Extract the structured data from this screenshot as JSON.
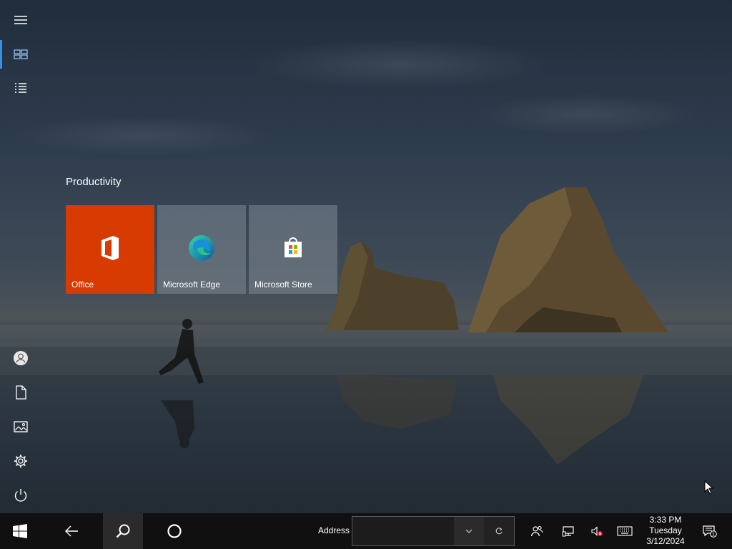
{
  "start": {
    "rail": {
      "menu_icon": "hamburger-icon",
      "tiles_icon": "pinned-tiles-icon",
      "all_apps_icon": "all-apps-list-icon",
      "user_icon": "user-avatar-icon",
      "documents_icon": "documents-icon",
      "pictures_icon": "pictures-icon",
      "settings_icon": "gear-icon",
      "power_icon": "power-icon"
    },
    "group_title": "Productivity",
    "tiles": [
      {
        "label": "Office",
        "icon": "office-icon",
        "color": "#d83b01"
      },
      {
        "label": "Microsoft Edge",
        "icon": "edge-icon"
      },
      {
        "label": "Microsoft Store",
        "icon": "store-icon"
      }
    ]
  },
  "taskbar": {
    "start_icon": "windows-logo-icon",
    "back_icon": "back-arrow-icon",
    "search_icon": "search-icon",
    "cortana_icon": "cortana-circle-icon",
    "address_label": "Address",
    "address_value": "",
    "tray": {
      "people_icon": "people-icon",
      "network_icon": "network-icon",
      "volume_icon": "volume-muted-icon",
      "keyboard_icon": "touch-keyboard-icon",
      "notification_icon": "action-center-icon",
      "notification_count": "1"
    },
    "clock": {
      "time": "3:33 PM",
      "day": "Tuesday",
      "date": "3/12/2024"
    }
  },
  "colors": {
    "accent": "#3a8fe0",
    "office_tile": "#d83b01",
    "taskbar": "#101010"
  }
}
